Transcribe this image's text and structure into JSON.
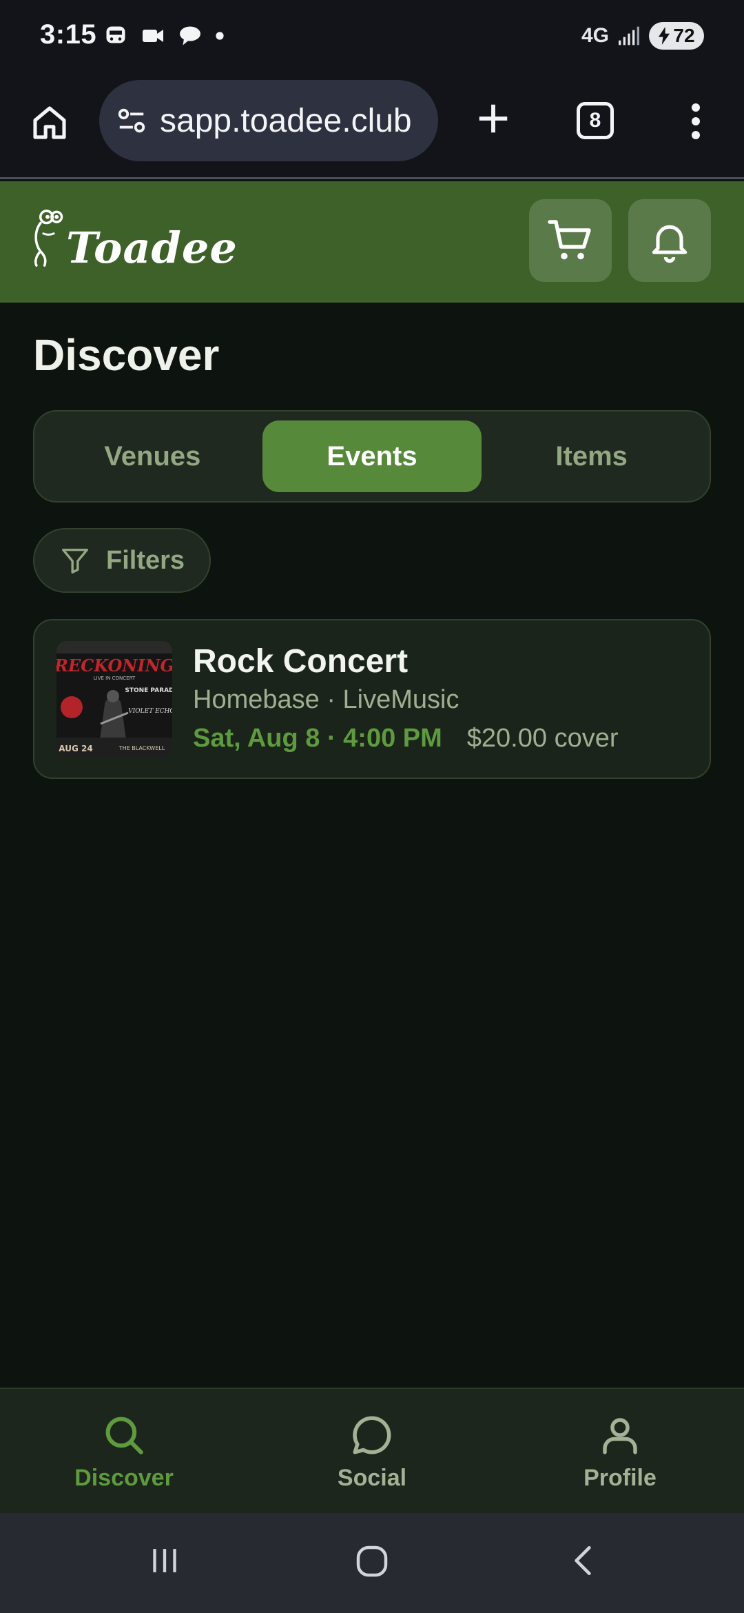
{
  "status_bar": {
    "time": "3:15",
    "network": "4G",
    "battery": "72"
  },
  "browser": {
    "url": "sapp.toadee.club",
    "tab_count": "8"
  },
  "app": {
    "logo_text": "Toadee",
    "brand_color": "#3d6129",
    "accent_color": "#568a3a"
  },
  "main": {
    "title": "Discover",
    "tabs": [
      {
        "label": "Venues"
      },
      {
        "label": "Events"
      },
      {
        "label": "Items"
      }
    ],
    "active_tab": "Events",
    "filters_label": "Filters",
    "events": [
      {
        "title": "Rock Concert",
        "meta": "Homebase · LiveMusic",
        "datetime": "Sat, Aug 8 · 4:00 PM",
        "price": "$20.00 cover",
        "poster": {
          "headline": "RECKONING",
          "subline": "LIVE IN CONCERT",
          "band1": "STONE PARADE",
          "band2": "VIOLET ECHO",
          "date": "AUG 24",
          "venue": "THE BLACKWELL"
        }
      }
    ]
  },
  "bottom_nav": [
    {
      "label": "Discover",
      "icon": "search-icon"
    },
    {
      "label": "Social",
      "icon": "chat-bubble-icon"
    },
    {
      "label": "Profile",
      "icon": "user-icon"
    }
  ]
}
